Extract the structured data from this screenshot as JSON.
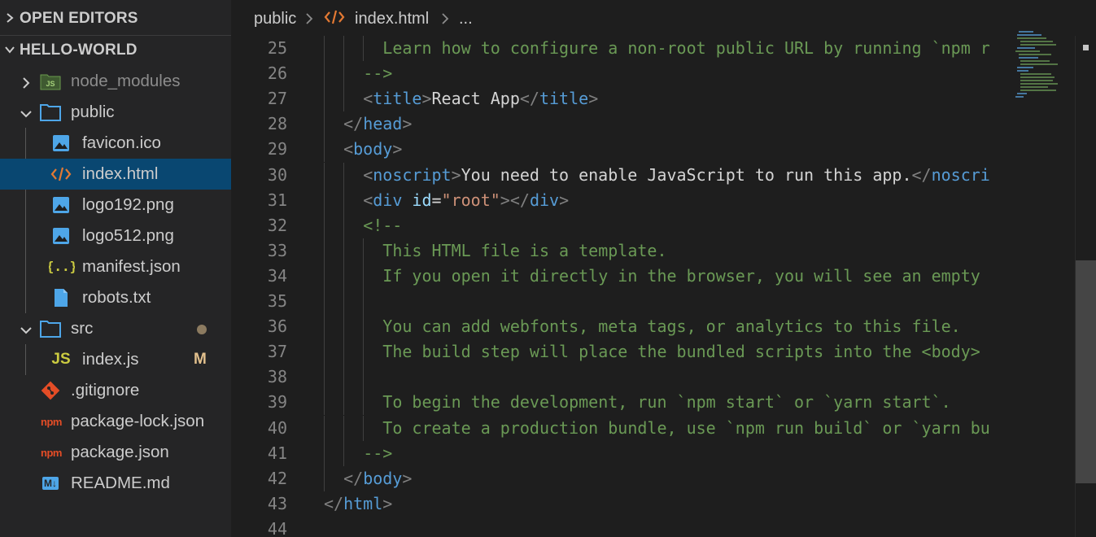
{
  "sidebar": {
    "open_editors": "OPEN EDITORS",
    "project": "HELLO-WORLD",
    "items": [
      {
        "label": "node_modules",
        "type": "folder",
        "icon": "node-folder-icon"
      },
      {
        "label": "public",
        "type": "folder",
        "icon": "folder-icon"
      },
      {
        "label": "favicon.ico",
        "type": "file",
        "icon": "image-icon"
      },
      {
        "label": "index.html",
        "type": "file",
        "icon": "html-icon"
      },
      {
        "label": "logo192.png",
        "type": "file",
        "icon": "image-icon"
      },
      {
        "label": "logo512.png",
        "type": "file",
        "icon": "image-icon"
      },
      {
        "label": "manifest.json",
        "type": "file",
        "icon": "json-icon"
      },
      {
        "label": "robots.txt",
        "type": "file",
        "icon": "file-icon"
      },
      {
        "label": "src",
        "type": "folder",
        "icon": "folder-icon"
      },
      {
        "label": "index.js",
        "type": "file",
        "icon": "js-icon",
        "status": "M",
        "js_badge": "JS"
      },
      {
        "label": ".gitignore",
        "type": "file",
        "icon": "git-icon"
      },
      {
        "label": "package-lock.json",
        "type": "file",
        "icon": "npm-icon",
        "npm_badge": "npm"
      },
      {
        "label": "package.json",
        "type": "file",
        "icon": "npm-icon",
        "npm_badge": "npm"
      },
      {
        "label": "README.md",
        "type": "file",
        "icon": "markdown-icon",
        "md_badge": "M↓"
      }
    ]
  },
  "breadcrumb": {
    "folder": "public",
    "file": "index.html",
    "ellipsis": "..."
  },
  "editor": {
    "lines": [
      {
        "n": "25",
        "indent": 3,
        "text": "Learn how to configure a non-root public URL by running `npm r"
      },
      {
        "n": "26",
        "indent": 2,
        "text": "-->"
      },
      {
        "n": "27",
        "indent": 2,
        "text": "<title>React App</title>"
      },
      {
        "n": "28",
        "indent": 1,
        "text": "</head>"
      },
      {
        "n": "29",
        "indent": 1,
        "text": "<body>"
      },
      {
        "n": "30",
        "indent": 2,
        "text": "<noscript>You need to enable JavaScript to run this app.</noscri"
      },
      {
        "n": "31",
        "indent": 2,
        "text": "<div id=\"root\"></div>"
      },
      {
        "n": "32",
        "indent": 2,
        "text": "<!--"
      },
      {
        "n": "33",
        "indent": 3,
        "text": "This HTML file is a template."
      },
      {
        "n": "34",
        "indent": 3,
        "text": "If you open it directly in the browser, you will see an empty"
      },
      {
        "n": "35",
        "indent": 3,
        "text": ""
      },
      {
        "n": "36",
        "indent": 3,
        "text": "You can add webfonts, meta tags, or analytics to this file."
      },
      {
        "n": "37",
        "indent": 3,
        "text": "The build step will place the bundled scripts into the <body>"
      },
      {
        "n": "38",
        "indent": 3,
        "text": ""
      },
      {
        "n": "39",
        "indent": 3,
        "text": "To begin the development, run `npm start` or `yarn start`."
      },
      {
        "n": "40",
        "indent": 3,
        "text": "To create a production bundle, use `npm run build` or `yarn bu"
      },
      {
        "n": "41",
        "indent": 2,
        "text": "-->"
      },
      {
        "n": "42",
        "indent": 1,
        "text": "</body>"
      },
      {
        "n": "43",
        "indent": 0,
        "text": "</html>"
      },
      {
        "n": "44",
        "indent": 0,
        "text": ""
      }
    ]
  },
  "colors": {
    "selection": "#094771",
    "tag": "#569cd6",
    "comment": "#6a9955",
    "attr": "#9cdcfe",
    "string": "#ce9178",
    "modified": "#e2c08d"
  }
}
